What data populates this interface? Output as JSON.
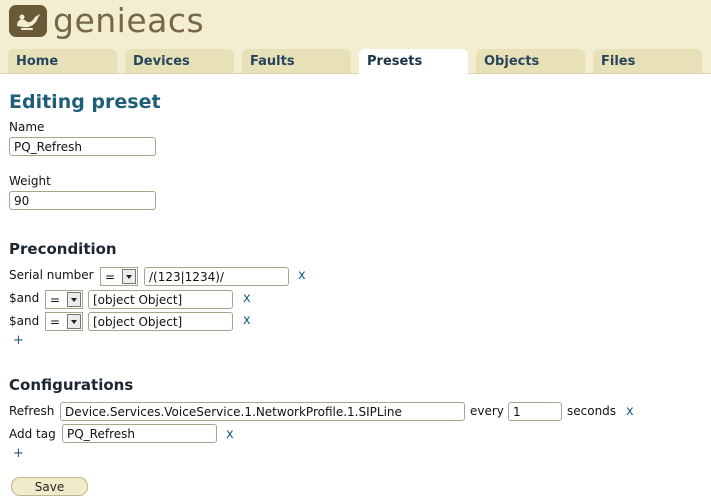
{
  "app": {
    "logo_text": "genieacs"
  },
  "tabs": [
    {
      "label": "Home"
    },
    {
      "label": "Devices"
    },
    {
      "label": "Faults"
    },
    {
      "label": "Presets"
    },
    {
      "label": "Objects"
    },
    {
      "label": "Files"
    }
  ],
  "active_tab": "Presets",
  "page_title": "Editing preset",
  "fields": {
    "name_label": "Name",
    "name_value": "PQ_Refresh",
    "weight_label": "Weight",
    "weight_value": "90"
  },
  "precondition": {
    "title": "Precondition",
    "rows": [
      {
        "key": "Serial number",
        "op": "=",
        "value": "/(123|1234)/",
        "remove": "x"
      },
      {
        "key": "$and",
        "op": "=",
        "value": "[object Object]",
        "remove": "x"
      },
      {
        "key": "$and",
        "op": "=",
        "value": "[object Object]",
        "remove": "x"
      }
    ],
    "add": "+"
  },
  "configurations": {
    "title": "Configurations",
    "refresh": {
      "label": "Refresh",
      "path": "Device.Services.VoiceService.1.NetworkProfile.1.SIPLine",
      "every_label": "every",
      "interval": "1",
      "unit_label": "seconds",
      "remove": "x"
    },
    "add_tag": {
      "label": "Add tag",
      "value": "PQ_Refresh",
      "remove": "x"
    },
    "add": "+"
  },
  "save_label": "Save",
  "colors": {
    "header_bg": "#f3eed2",
    "tab_bg": "#e8e1b8",
    "title": "#1f5e7a",
    "logo": "#786745"
  }
}
